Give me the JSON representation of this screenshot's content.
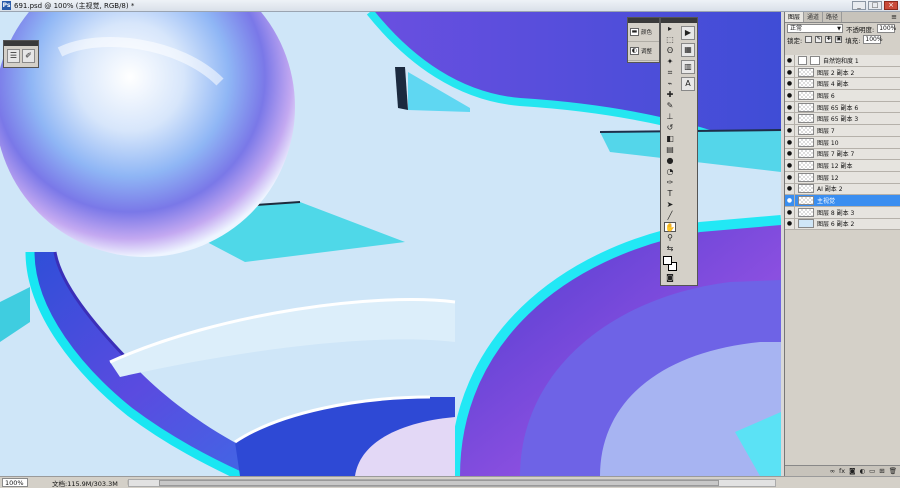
{
  "window": {
    "title": "691.psd @ 100% (主视觉, RGB/8) *",
    "controls": [
      "_",
      "□",
      "×"
    ]
  },
  "status": {
    "zoom": "100%",
    "doc_info": "文档:115.9M/303.3M",
    "arrow": "▶"
  },
  "adjust_panel": {
    "items": [
      {
        "icon": "histogram-icon",
        "label": "颜色"
      },
      {
        "icon": "adjust-icon",
        "label": "调整"
      }
    ]
  },
  "layers_panel": {
    "tabs": [
      "图层",
      "通道",
      "路径"
    ],
    "blend_mode": "正常",
    "opacity_label": "不透明度:",
    "opacity_value": "100%",
    "lock_label": "锁定:",
    "fill_label": "填充:",
    "fill_value": "100%",
    "layers": [
      {
        "name": "自然饱和度 1",
        "type": "adjustment",
        "visible": true
      },
      {
        "name": "图层 2 副本 2",
        "type": "pixel",
        "visible": true
      },
      {
        "name": "图层 4 副本",
        "type": "pixel",
        "visible": true
      },
      {
        "name": "图层 6",
        "type": "pixel",
        "visible": true
      },
      {
        "name": "图层 65 副本 6",
        "type": "pixel",
        "visible": true
      },
      {
        "name": "图层 65 副本 3",
        "type": "pixel",
        "visible": true
      },
      {
        "name": "图层 7",
        "type": "pixel",
        "visible": true
      },
      {
        "name": "图层 10",
        "type": "pixel",
        "visible": true
      },
      {
        "name": "图层 7 副本 7",
        "type": "pixel",
        "visible": true
      },
      {
        "name": "图层 12 副本",
        "type": "pixel",
        "visible": true
      },
      {
        "name": "图层 12",
        "type": "pixel",
        "visible": true
      },
      {
        "name": "AI 副本 2",
        "type": "pixel",
        "visible": true
      },
      {
        "name": "主视觉",
        "type": "pixel",
        "visible": true,
        "selected": true
      },
      {
        "name": "图层 8 副本 3",
        "type": "pixel",
        "visible": true
      },
      {
        "name": "图层 6 副本 2",
        "type": "image",
        "visible": true
      }
    ]
  }
}
